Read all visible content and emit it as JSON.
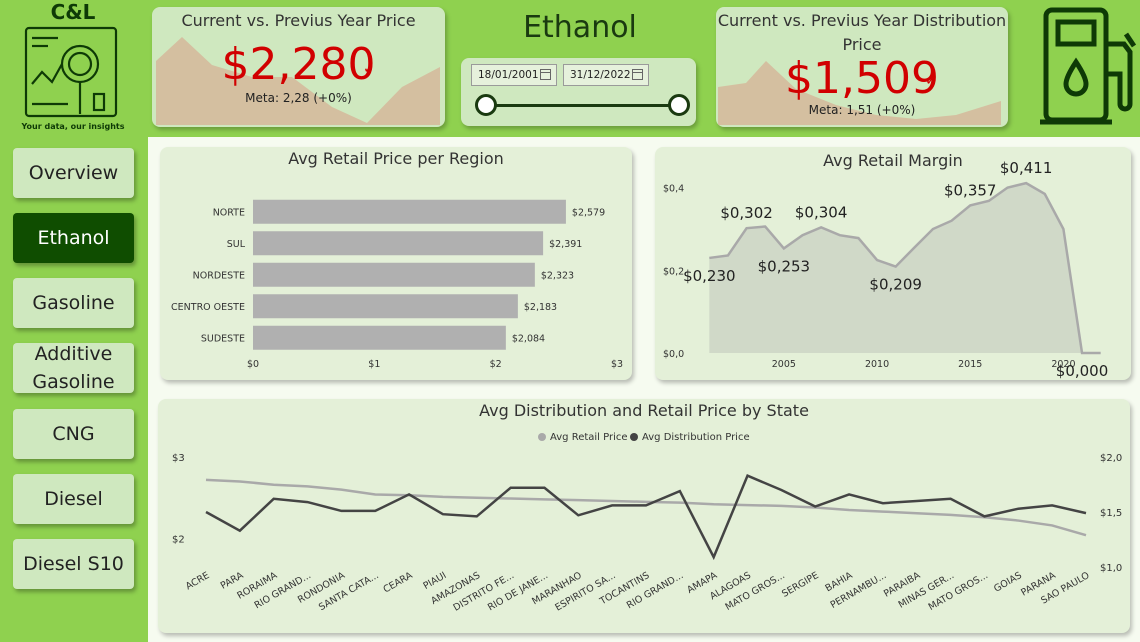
{
  "logo": {
    "title": "C&L",
    "tagline": "Your data, our insights"
  },
  "kpi_retail": {
    "title": "Current vs. Previus Year Price",
    "value": "$2,280",
    "meta": "Meta: 2,28 (+0%)"
  },
  "page_title": "Ethanol",
  "date_range": {
    "start": "18/01/2001",
    "end": "31/12/2022"
  },
  "kpi_distribution": {
    "title": "Current vs. Previus Year Distribution Price",
    "value": "$1,509",
    "meta": "Meta: 1,51 (+0%)"
  },
  "nav": [
    "Overview",
    "Ethanol",
    "Gasoline",
    "Additive Gasoline",
    "CNG",
    "Diesel",
    "Diesel S10"
  ],
  "nav_active": "Ethanol",
  "colors": {
    "background": "#8fd14f",
    "active_nav": "#0f4d00",
    "kpi_red": "#d10000",
    "bar": "#b0b0b0",
    "dark_line": "#444444",
    "light_line": "#a9a9a9"
  },
  "chart_data": [
    {
      "type": "bar",
      "title": "Avg Retail Price per Region",
      "categories": [
        "NORTE",
        "SUL",
        "NORDESTE",
        "CENTRO OESTE",
        "SUDESTE"
      ],
      "values": [
        2.579,
        2.391,
        2.323,
        2.183,
        2.084
      ],
      "value_labels": [
        "$2,579",
        "$2,391",
        "$2,323",
        "$2,183",
        "$2,084"
      ],
      "xlim": [
        0,
        3
      ],
      "xticks": [
        "$0",
        "$1",
        "$2",
        "$3"
      ]
    },
    {
      "type": "area",
      "title": "Avg Retail Margin",
      "x": [
        2001,
        2002,
        2003,
        2004,
        2005,
        2006,
        2007,
        2008,
        2009,
        2010,
        2011,
        2012,
        2013,
        2014,
        2015,
        2016,
        2017,
        2018,
        2019,
        2020,
        2021,
        2022
      ],
      "values": [
        0.23,
        0.236,
        0.302,
        0.306,
        0.253,
        0.285,
        0.304,
        0.285,
        0.278,
        0.225,
        0.209,
        0.255,
        0.3,
        0.32,
        0.357,
        0.368,
        0.4,
        0.411,
        0.385,
        0.3,
        0.0,
        0.0
      ],
      "data_labels": [
        {
          "x": 2001,
          "text": "$0,230"
        },
        {
          "x": 2003,
          "text": "$0,302"
        },
        {
          "x": 2005,
          "text": "$0,253"
        },
        {
          "x": 2007,
          "text": "$0,304"
        },
        {
          "x": 2011,
          "text": "$0,209"
        },
        {
          "x": 2015,
          "text": "$0,357"
        },
        {
          "x": 2018,
          "text": "$0,411"
        },
        {
          "x": 2021,
          "text": "$0,000"
        }
      ],
      "ylim": [
        0,
        0.45
      ],
      "yticks": [
        "$0,0",
        "$0,2",
        "$0,4"
      ],
      "xticks": [
        "2005",
        "2010",
        "2015",
        "2020"
      ]
    },
    {
      "type": "line",
      "title": "Avg Distribution and Retail Price by State",
      "categories": [
        "ACRE",
        "PARA",
        "RORAIMA",
        "RIO GRAND...",
        "RONDONIA",
        "SANTA CATA...",
        "CEARA",
        "PIAUI",
        "AMAZONAS",
        "DISTRITO FE...",
        "RIO DE JANE...",
        "MARANHAO",
        "ESPIRITO SA...",
        "TOCANTINS",
        "RIO GRAND...",
        "AMAPA",
        "ALAGOAS",
        "MATO GROS...",
        "SERGIPE",
        "BAHIA",
        "PERNAMBU...",
        "PARAIBA",
        "MINAS GER...",
        "MATO GROS...",
        "GOIAS",
        "PARANA",
        "SAO PAULO"
      ],
      "series": [
        {
          "name": "Avg Retail Price",
          "axis": "left",
          "values": [
            2.72,
            2.7,
            2.66,
            2.64,
            2.6,
            2.54,
            2.53,
            2.51,
            2.5,
            2.49,
            2.48,
            2.47,
            2.46,
            2.45,
            2.44,
            2.42,
            2.41,
            2.4,
            2.38,
            2.35,
            2.33,
            2.31,
            2.29,
            2.26,
            2.22,
            2.16,
            2.04
          ]
        },
        {
          "name": "Avg Distribution Price",
          "axis": "right",
          "values": [
            1.5,
            1.33,
            1.62,
            1.59,
            1.51,
            1.51,
            1.66,
            1.48,
            1.46,
            1.72,
            1.72,
            1.47,
            1.56,
            1.56,
            1.69,
            1.09,
            1.83,
            1.7,
            1.55,
            1.66,
            1.58,
            1.6,
            1.62,
            1.46,
            1.53,
            1.56,
            1.49
          ]
        }
      ],
      "y_left": {
        "lim": [
          1.65,
          3.0
        ],
        "ticks": [
          "$3",
          "$2"
        ]
      },
      "y_right": {
        "lim": [
          1.0,
          2.0
        ],
        "ticks": [
          "$2,0",
          "$1,5",
          "$1,0"
        ]
      }
    }
  ]
}
